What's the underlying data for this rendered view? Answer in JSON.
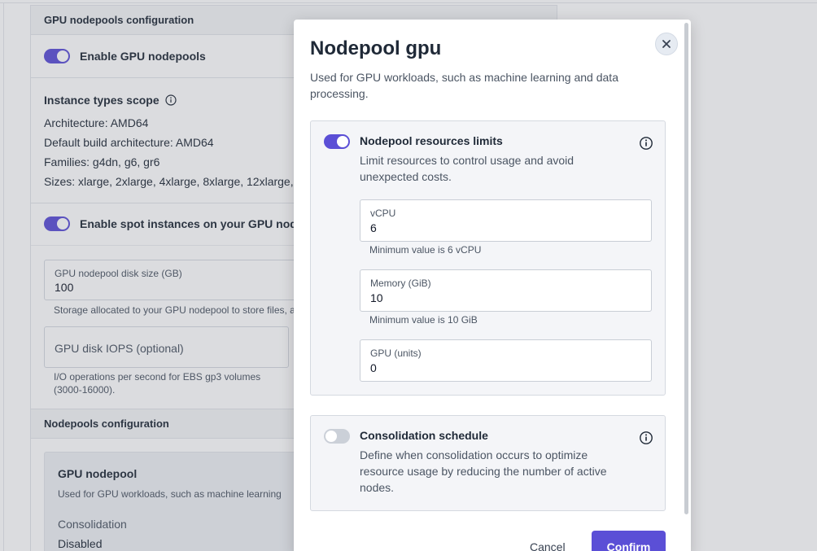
{
  "background": {
    "gpu_section_title": "GPU nodepools configuration",
    "enable_gpu_label": "Enable GPU nodepools",
    "instance_scope_label": "Instance types scope",
    "architecture_label": "Architecture:",
    "architecture_value": "AMD64",
    "default_arch_label": "Default build architecture:",
    "default_arch_value": "AMD64",
    "families_label": "Families:",
    "families_value": "g4dn, g6, gr6",
    "sizes_label": "Sizes:",
    "sizes_value": "xlarge, 2xlarge, 4xlarge, 8xlarge, 12xlarge, 1",
    "spot_label": "Enable spot instances on your GPU nodep",
    "disk_size_label": "GPU nodepool disk size (GB)",
    "disk_size_value": "100",
    "disk_size_help": "Storage allocated to your GPU nodepool to store files, a",
    "iops_placeholder": "GPU disk IOPS (optional)",
    "iops_help": "I/O operations per second for EBS gp3 volumes (3000-16000).",
    "nodepools_section_title": "Nodepools configuration",
    "nodepool_card_title": "GPU nodepool",
    "nodepool_card_desc": "Used for GPU workloads, such as machine learning",
    "consolidation_label": "Consolidation",
    "consolidation_value": "Disabled"
  },
  "modal": {
    "title": "Nodepool gpu",
    "subtitle": "Used for GPU workloads, such as machine learning and data processing.",
    "close_icon": "close-icon",
    "resources": {
      "title": "Nodepool resources limits",
      "description": "Limit resources to control usage and avoid unexpected costs.",
      "enabled": true,
      "vcpu_label": "vCPU",
      "vcpu_value": "6",
      "vcpu_hint": "Minimum value is 6 vCPU",
      "memory_label": "Memory (GiB)",
      "memory_value": "10",
      "memory_hint": "Minimum value is 10 GiB",
      "gpu_label": "GPU (units)",
      "gpu_value": "0"
    },
    "consolidation": {
      "title": "Consolidation schedule",
      "description": "Define when consolidation occurs to optimize resource usage by reducing the number of active nodes.",
      "enabled": false
    },
    "cancel_label": "Cancel",
    "confirm_label": "Confirm"
  },
  "colors": {
    "accent": "#5b4fd6",
    "panel_bg": "#f4f5f8",
    "toggle_off": "#cbd0d8"
  }
}
